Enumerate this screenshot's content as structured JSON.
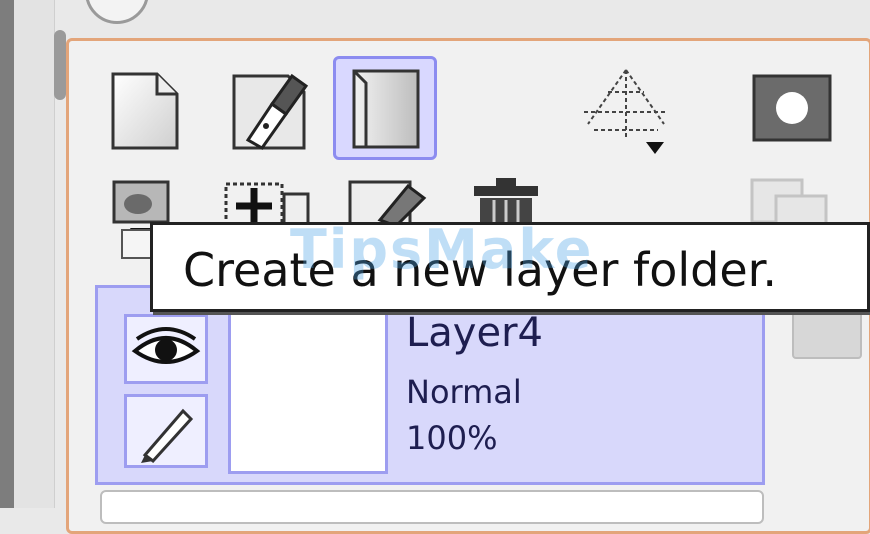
{
  "layer_toolbar": {
    "buttons_row1": [
      {
        "name": "new-layer",
        "icon": "new-layer-icon"
      },
      {
        "name": "new-linework-layer",
        "icon": "pen-layer-icon"
      },
      {
        "name": "new-layer-folder",
        "icon": "layer-folder-icon",
        "selected": true
      },
      {
        "name": "perspective-ruler",
        "icon": "perspective-ruler-icon"
      },
      {
        "name": "layer-mask",
        "icon": "mask-icon"
      }
    ],
    "buttons_row2": [
      {
        "name": "transfer-down",
        "icon": "transfer-down-icon"
      },
      {
        "name": "merge-down",
        "icon": "merge-down-icon"
      },
      {
        "name": "clear-layer",
        "icon": "eraser-layer-icon"
      },
      {
        "name": "delete-layer",
        "icon": "trash-icon"
      },
      {
        "name": "copy-layer",
        "icon": "copy-layer-icon"
      }
    ]
  },
  "tooltip": {
    "text": "Create a new layer folder."
  },
  "watermark": {
    "text": "TipsMake"
  },
  "layer": {
    "name": "Layer4",
    "mode": "Normal",
    "opacity": "100%",
    "selected_color": "#d8d8fb",
    "border_color": "#9d9df0"
  },
  "colors": {
    "panel_border": "#e3a57a",
    "selected_button_bg": "#d9d8ff",
    "selected_button_border": "#8c8cf0"
  }
}
